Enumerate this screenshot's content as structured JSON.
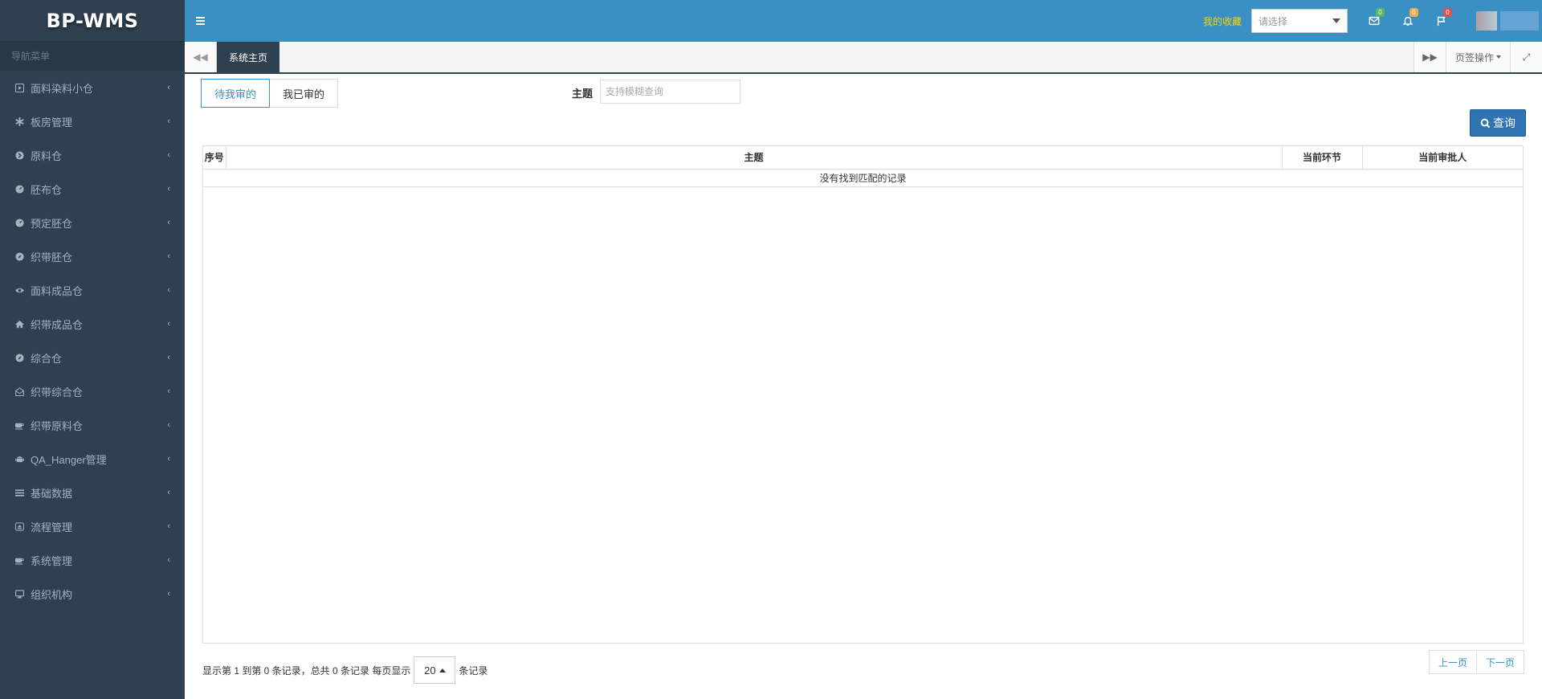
{
  "app": {
    "logo": "BP-WMS"
  },
  "sidebar": {
    "header": "导航菜单",
    "items": [
      {
        "label": "面料染料小仓",
        "icon": "play-square-icon"
      },
      {
        "label": "板房管理",
        "icon": "asterisk-icon"
      },
      {
        "label": "原料仓",
        "icon": "chevron-circle-icon"
      },
      {
        "label": "胚布仓",
        "icon": "dashboard-icon"
      },
      {
        "label": "预定胚仓",
        "icon": "dashboard-icon"
      },
      {
        "label": "织带胚仓",
        "icon": "compass-icon"
      },
      {
        "label": "面料成品仓",
        "icon": "eye-icon"
      },
      {
        "label": "织带成品仓",
        "icon": "home-icon"
      },
      {
        "label": "综合仓",
        "icon": "compass-icon"
      },
      {
        "label": "织带综合仓",
        "icon": "envelope-open-icon"
      },
      {
        "label": "织带原料仓",
        "icon": "coffee-icon"
      },
      {
        "label": "QA_Hanger管理",
        "icon": "android-icon"
      },
      {
        "label": "基础数据",
        "icon": "bars-icon"
      },
      {
        "label": "流程管理",
        "icon": "eject-icon"
      },
      {
        "label": "系统管理",
        "icon": "coffee-icon"
      },
      {
        "label": "组织机构",
        "icon": "desktop-icon"
      }
    ]
  },
  "topbar": {
    "favorites_label": "我的收藏",
    "favorites_placeholder": "请选择",
    "mail_count": "0",
    "bell_count": "0",
    "flag_count": "0",
    "colors": {
      "bar": "#3a8fc3",
      "favorites": "#ffd400"
    }
  },
  "tabs": {
    "active": "系统主页",
    "page_ops": "页签操作"
  },
  "main": {
    "segments": [
      "待我审的",
      "我已审的"
    ],
    "filter_label": "主题",
    "filter_placeholder": "支持模糊查询",
    "search_button": "查询",
    "table": {
      "columns": [
        "序号",
        "主题",
        "当前环节",
        "当前审批人"
      ],
      "empty_text": "没有找到匹配的记录"
    },
    "pager": {
      "info": "显示第 1 到第 0 条记录，总共 0 条记录 每页显示",
      "page_size": "20",
      "suffix": "条记录",
      "prev": "上一页",
      "next": "下一页"
    }
  }
}
